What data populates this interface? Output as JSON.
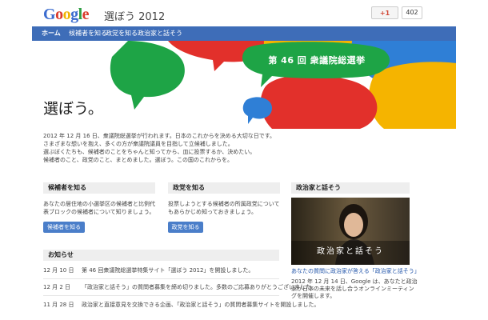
{
  "header": {
    "logo_letters": [
      "G",
      "o",
      "o",
      "g",
      "l",
      "e"
    ],
    "logo_colors": [
      "#3b6ccf",
      "#d93a2b",
      "#f0b400",
      "#3b6ccf",
      "#2e9e42",
      "#d93a2b"
    ],
    "site_title": "選ぼう 2012",
    "plus_one": "+1",
    "plus_count": "402"
  },
  "nav": {
    "items": [
      {
        "label": "ホーム"
      },
      {
        "label": "候補者を知る"
      },
      {
        "label": "政党を知る"
      },
      {
        "label": "政治家と話そう"
      }
    ]
  },
  "hero": {
    "election_title": "第 46 回 衆議院総選挙",
    "tagline": "選ぼう。",
    "colors": {
      "red": "#e2302b",
      "yellow": "#f5b400",
      "green": "#1ea446",
      "blue": "#2f7fd6",
      "lightblue": "#4aa3e8"
    }
  },
  "intro": {
    "lines": [
      "2012 年 12 月 16 日、衆議院総選挙が行われます。日本のこれからを決める大切な日です。",
      "さまざまな想いを抱え、多くの方が衆議院議員を目指して立候補しました。",
      "選ぶぼくたちも、候補者のことをちゃんと知ってから、皿に投票するか、決めたい。",
      "候補者のこと、政党のこと、まとめました。選ぼう。この国のこれからを。"
    ]
  },
  "candidates": {
    "heading": "候補者を知る",
    "desc": "あなたの居住地の小選挙区の候補者と比例代表ブロックの候補者について知りましょう。",
    "button": "候補者を知る"
  },
  "parties": {
    "heading": "政党を知る",
    "desc": "投票しようとする候補者の所属政党についてもあらかじめ知っておきましょう。",
    "button": "政党を知る"
  },
  "talk": {
    "heading": "政治家と話そう",
    "photo_caption": "政治家と話そう",
    "link": "あなたの質問に政治家が答える「政治家と話そう」",
    "desc": "2012 年 12 月 14 日、Google は、あなたと政治家が日本の未来を話し合うオンラインミーティングを開催します。"
  },
  "news": {
    "heading": "お知らせ",
    "items": [
      {
        "date": "12 月 10 日",
        "text": "第 46 回衆議院総選挙特集サイト「選ぼう 2012」を開設しました。"
      },
      {
        "date": "12 月 2 日",
        "text": "「政治家と話そう」の質問者募集を締め切りました。多数のご応募ありがとうございました。"
      },
      {
        "date": "11 月 28 日",
        "text": "政治家と直接意見を交換できる企画、「政治家と話そう」の質問者募集サイトを開設しました。"
      }
    ]
  }
}
